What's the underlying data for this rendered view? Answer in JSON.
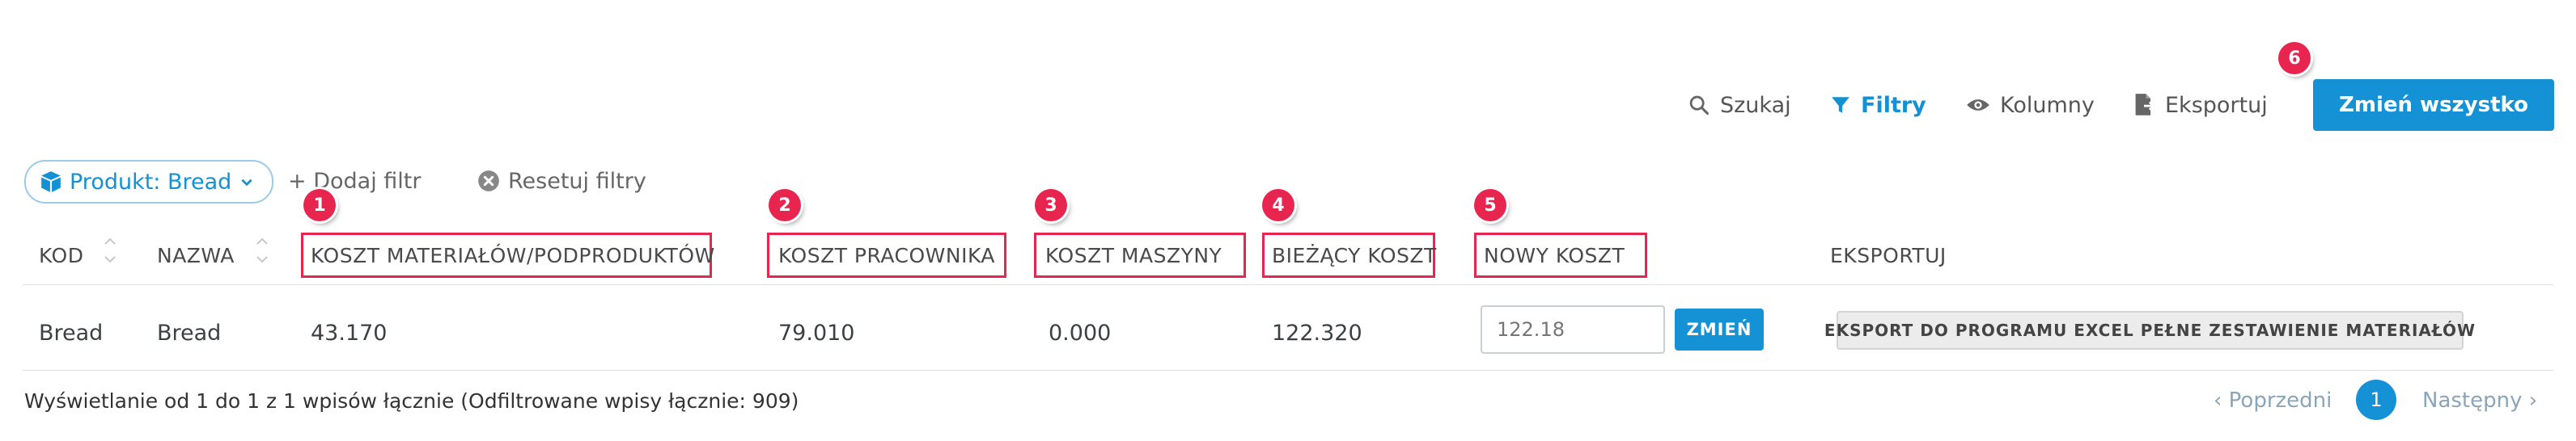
{
  "toolbar": {
    "search_label": "Szukaj",
    "filters_label": "Filtry",
    "columns_label": "Kolumny",
    "export_label": "Eksportuj",
    "change_all_label": "Zmień wszystko"
  },
  "filters": {
    "chip_label": "Produkt: Bread",
    "add_filter_label": "+ Dodaj filtr",
    "reset_filters_label": "Resetuj filtry"
  },
  "markers": [
    "1",
    "2",
    "3",
    "4",
    "5",
    "6"
  ],
  "table": {
    "headers": {
      "kod": "KOD",
      "nazwa": "NAZWA",
      "material_cost": "KOSZT MATERIAŁÓW/PODPRODUKTÓW",
      "worker_cost": "KOSZT PRACOWNIKA",
      "machine_cost": "KOSZT MASZYNY",
      "current_cost": "BIEŻĄCY KOSZT",
      "new_cost": "NOWY KOSZT",
      "export": "EKSPORTUJ"
    },
    "rows": [
      {
        "kod": "Bread",
        "nazwa": "Bread",
        "material_cost": "43.170",
        "worker_cost": "79.010",
        "machine_cost": "0.000",
        "current_cost": "122.320",
        "new_cost_placeholder": "122.18",
        "change_label": "ZMIEŃ",
        "export_label": "EKSPORT DO PROGRAMU EXCEL PEŁNE ZESTAWIENIE MATERIAŁÓW"
      }
    ]
  },
  "footer": {
    "info": "Wyświetlanie od 1 do 1 z 1 wpisów łącznie (Odfiltrowane wpisy łącznie: 909)",
    "prev_label": "‹ Poprzedni",
    "current_page": "1",
    "next_label": "Następny ›"
  },
  "colors": {
    "accent": "#1592d6",
    "marker": "#e8254f",
    "highlight_border": "#e8254f"
  }
}
